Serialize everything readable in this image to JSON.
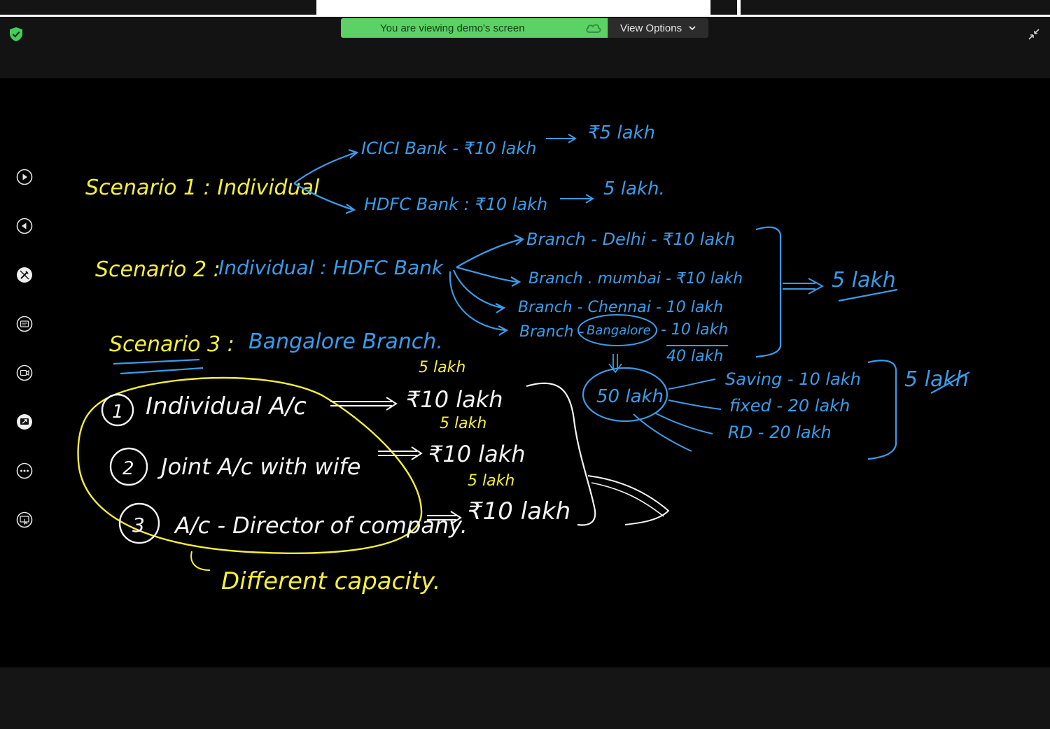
{
  "banner": {
    "message": "You are viewing demo's screen",
    "options_label": "View Options"
  },
  "toolbar": {
    "items": [
      {
        "icon": "play-icon"
      },
      {
        "icon": "rewind-icon"
      },
      {
        "icon": "annotate-icon"
      },
      {
        "icon": "captions-icon"
      },
      {
        "icon": "record-icon"
      },
      {
        "icon": "share-screen-icon"
      },
      {
        "icon": "more-icon"
      },
      {
        "icon": "remote-control-icon"
      }
    ]
  },
  "whiteboard": {
    "colors": {
      "yellow": "#f5ef3a",
      "blue": "#3a9ce8",
      "white": "#f4f4f4"
    },
    "scenario1": {
      "label": "Scenario 1 : Individual",
      "branch_top": "ICICI Bank - ₹10 lakh",
      "top_result": "₹5 lakh",
      "branch_bottom": "HDFC Bank : ₹10 lakh",
      "bottom_result": "5 lakh."
    },
    "scenario2": {
      "label": "Scenario 2 :",
      "detail": "Individual : HDFC Bank",
      "branches": [
        "Branch - Delhi - ₹10 lakh",
        "Branch . mumbai - ₹10 lakh",
        "Branch - Chennai - 10 lakh",
        "Branch -",
        "- 10 lakh"
      ],
      "bangalore": "Bangalore",
      "total": "40 lakh",
      "result": "5 lakh"
    },
    "scenario3": {
      "label": "Scenario 3 :",
      "detail": "Bangalore Branch.",
      "accounts": [
        {
          "num": "1",
          "text": "Individual A/c"
        },
        {
          "num": "2",
          "text": "Joint A/c with wife"
        },
        {
          "num": "3",
          "text": "A/c - Director of company."
        }
      ],
      "amounts": [
        "₹10 lakh",
        "₹10 lakh",
        "₹10 lakh"
      ],
      "insured": [
        "5 lakh",
        "5 lakh",
        "5 lakh"
      ],
      "note": "Different capacity."
    },
    "deposits": {
      "total": "50 lakh",
      "items": [
        "Saving - 10 lakh",
        "fixed - 20 lakh",
        "RD - 20 lakh"
      ],
      "result": "5 lakh"
    }
  }
}
